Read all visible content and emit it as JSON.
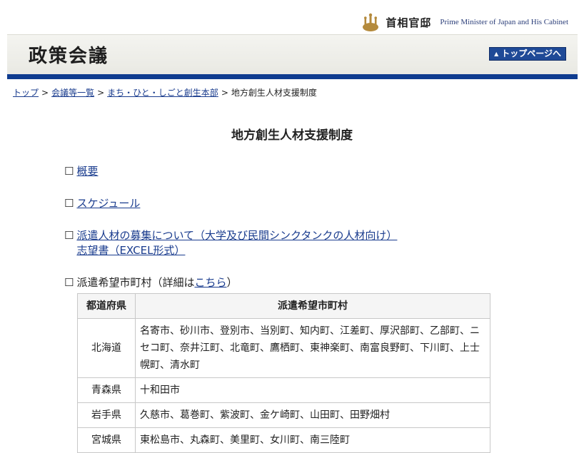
{
  "site": {
    "logo_jp": "首相官邸",
    "logo_en": "Prime Minister of Japan and His Cabinet",
    "header_title": "政策会議",
    "top_button": "トップページへ"
  },
  "breadcrumb": [
    {
      "label": "トップ",
      "link": true
    },
    {
      "label": "会議等一覧",
      "link": true
    },
    {
      "label": "まち・ひと・しごと創生本部",
      "link": true
    },
    {
      "label": "地方創生人材支援制度",
      "link": false
    }
  ],
  "page_title": "地方創生人材支援制度",
  "items": {
    "gaiyou": "概要",
    "schedule": "スケジュール",
    "recruit_line1": "派遣人材の募集について（大学及び民間シンクタンクの人材向け）",
    "recruit_line2": "志望書（EXCEL形式）",
    "kibou_prefix": "派遣希望市町村（詳細は",
    "kibou_link": "こちら",
    "kibou_suffix": "）"
  },
  "table": {
    "headers": [
      "都道府県",
      "派遣希望市町村"
    ],
    "rows": [
      {
        "pref": "北海道",
        "towns": "名寄市、砂川市、登別市、当別町、知内町、江差町、厚沢部町、乙部町、ニセコ町、奈井江町、北竜町、鷹栖町、東神楽町、南富良野町、下川町、上士幌町、清水町"
      },
      {
        "pref": "青森県",
        "towns": "十和田市"
      },
      {
        "pref": "岩手県",
        "towns": "久慈市、葛巻町、紫波町、金ケ崎町、山田町、田野畑村"
      },
      {
        "pref": "宮城県",
        "towns": "東松島市、丸森町、美里町、女川町、南三陸町"
      }
    ]
  },
  "colors": {
    "brand_blue": "#0f3c8f",
    "link": "#1a3c8e"
  }
}
